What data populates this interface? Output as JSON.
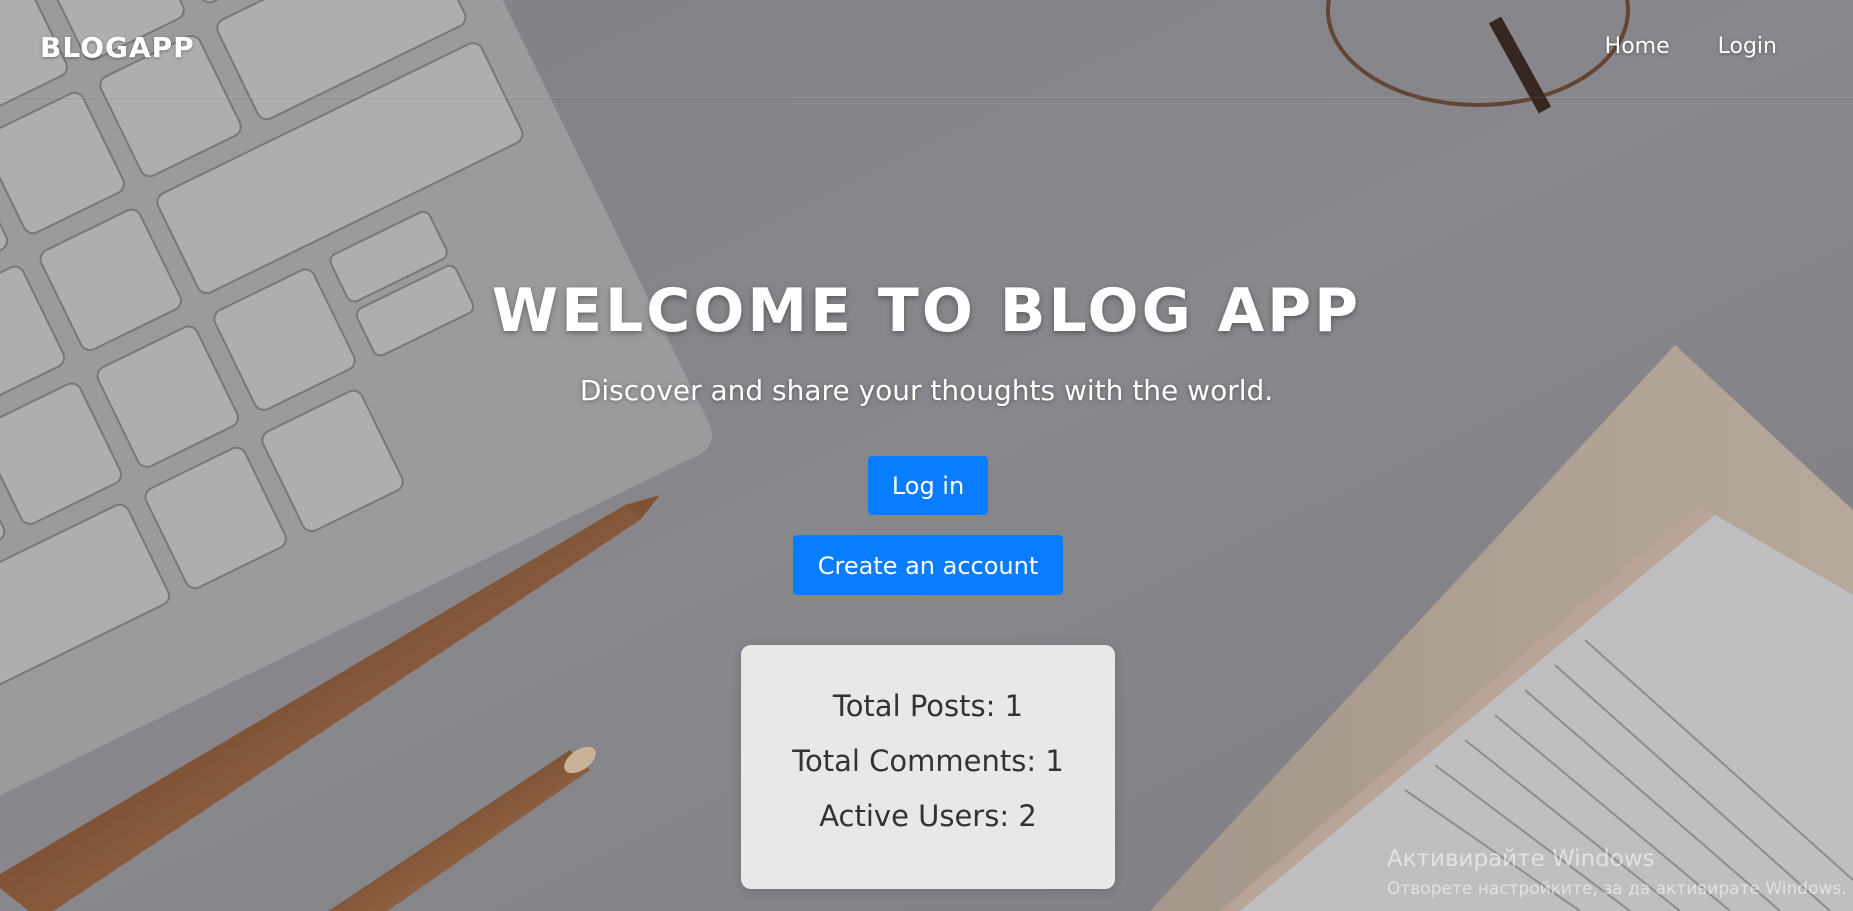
{
  "navbar": {
    "brand": "BLOGAPP",
    "links": [
      "Home",
      "Login"
    ]
  },
  "hero": {
    "title": "WELCOME TO BLOG APP",
    "subtitle": "Discover and share your thoughts with the world.",
    "buttons": {
      "login_label": "Log in",
      "create_label": "Create an account"
    }
  },
  "stats": {
    "total_posts": "Total Posts: 1",
    "total_comments": "Total Comments: 1",
    "active_users": "Active Users: 2"
  },
  "watermark": {
    "line1": "Активирайте Windows",
    "line2": "Отворете настройките, за да активирате Windows."
  },
  "colors": {
    "accent": "#0a7cff",
    "card_bg": "#ececec",
    "text_dark": "#333333"
  }
}
